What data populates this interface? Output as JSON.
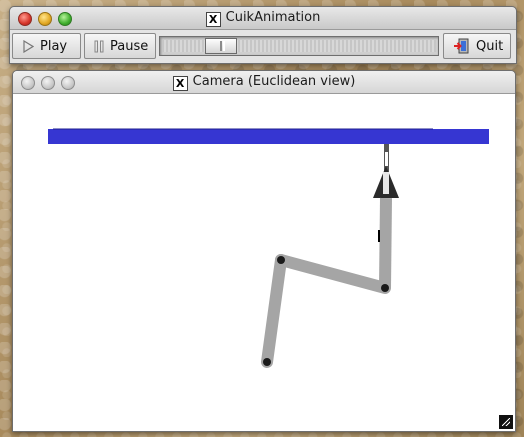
{
  "top_window": {
    "title": "CuikAnimation",
    "play_label": "Play",
    "pause_label": "Pause",
    "quit_label": "Quit",
    "slider_fraction": 0.22
  },
  "camera_window": {
    "title": "Camera (Euclidean view)"
  },
  "icons": {
    "window_app": "x11-icon",
    "play": "play-triangle-icon",
    "pause": "pause-bars-icon",
    "quit": "exit-door-icon"
  },
  "colors": {
    "ceiling_bar": "#3636d2",
    "links": "#a5a5a5",
    "joints": "#1a1a1a",
    "gripper": "#2b2b2b"
  }
}
